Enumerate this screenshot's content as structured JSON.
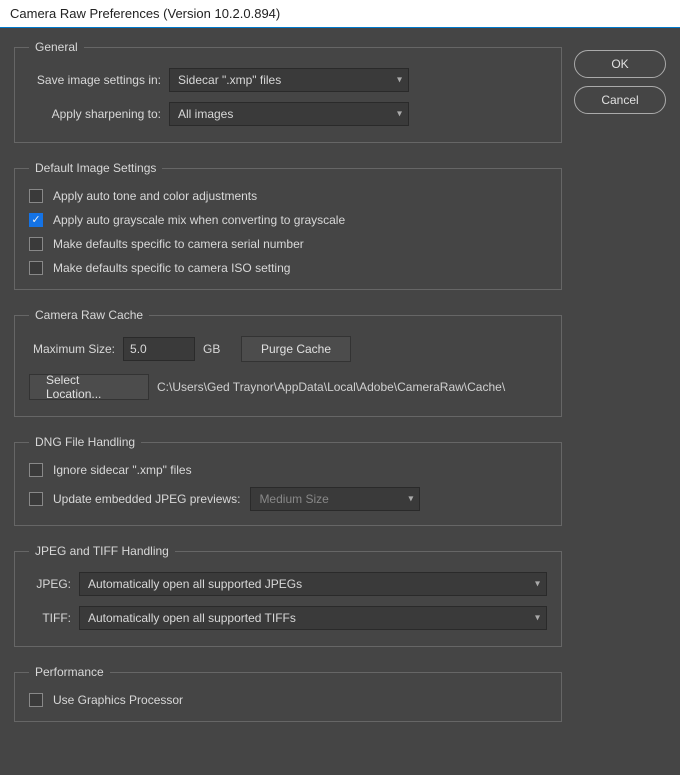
{
  "window": {
    "title": "Camera Raw Preferences  (Version 10.2.0.894)"
  },
  "buttons": {
    "ok": "OK",
    "cancel": "Cancel"
  },
  "general": {
    "legend": "General",
    "save_settings_label": "Save image settings in:",
    "save_settings_value": "Sidecar \".xmp\" files",
    "sharpening_label": "Apply sharpening to:",
    "sharpening_value": "All images"
  },
  "default_image": {
    "legend": "Default Image Settings",
    "auto_tone": {
      "checked": false,
      "label": "Apply auto tone and color adjustments"
    },
    "auto_grayscale": {
      "checked": true,
      "label": "Apply auto grayscale mix when converting to grayscale"
    },
    "serial": {
      "checked": false,
      "label": "Make defaults specific to camera serial number"
    },
    "iso": {
      "checked": false,
      "label": "Make defaults specific to camera ISO setting"
    }
  },
  "cache": {
    "legend": "Camera Raw Cache",
    "max_size_label": "Maximum Size:",
    "max_size_value": "5.0",
    "gb": "GB",
    "purge": "Purge Cache",
    "select_location": "Select Location...",
    "path": "C:\\Users\\Ged Traynor\\AppData\\Local\\Adobe\\CameraRaw\\Cache\\"
  },
  "dng": {
    "legend": "DNG File Handling",
    "ignore_sidecar": {
      "checked": false,
      "label": "Ignore sidecar \".xmp\" files"
    },
    "update_embedded": {
      "checked": false,
      "label": "Update embedded JPEG previews:"
    },
    "preview_value": "Medium Size"
  },
  "jpeg_tiff": {
    "legend": "JPEG and TIFF Handling",
    "jpeg_label": "JPEG:",
    "jpeg_value": "Automatically open all supported JPEGs",
    "tiff_label": "TIFF:",
    "tiff_value": "Automatically open all supported TIFFs"
  },
  "performance": {
    "legend": "Performance",
    "gpu": {
      "checked": false,
      "label": "Use Graphics Processor"
    }
  }
}
